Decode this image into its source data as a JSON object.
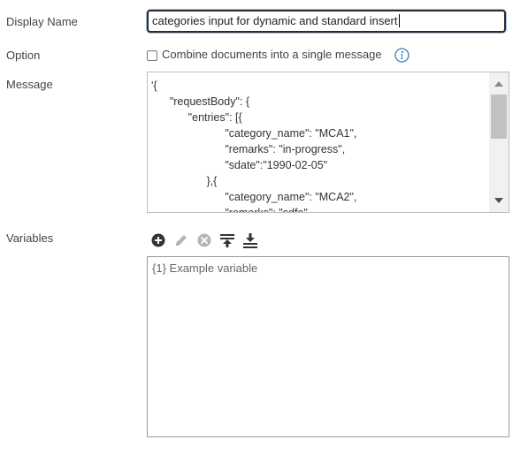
{
  "labels": {
    "display_name": "Display Name",
    "option": "Option",
    "message": "Message",
    "variables": "Variables"
  },
  "display_name": {
    "value": "categories input for dynamic and standard insert"
  },
  "option": {
    "checkbox_label": "Combine documents into a single message",
    "checked": false,
    "info_icon": "info-icon"
  },
  "message": {
    "value": "'{\n      \"requestBody\": {\n            \"entries\": [{\n                        \"category_name\": \"MCA1\",\n                        \"remarks\": \"in-progress\",\n                        \"sdate\":\"1990-02-05\"\n                  },{\n                        \"category_name\": \"MCA2\",\n                        \"remarks\": \"sdfa\","
  },
  "variables_toolbar": {
    "icons": [
      "add-icon",
      "edit-icon",
      "delete-icon",
      "move-top-icon",
      "move-bottom-icon"
    ]
  },
  "variables": {
    "items": [
      "{1} Example variable"
    ]
  },
  "colors": {
    "focus_border": "#2b2b2b",
    "focus_glow": "#9fc4e8",
    "info_blue": "#3d7fb5",
    "icon_dark": "#333333",
    "icon_disabled": "#b5b5b5"
  }
}
